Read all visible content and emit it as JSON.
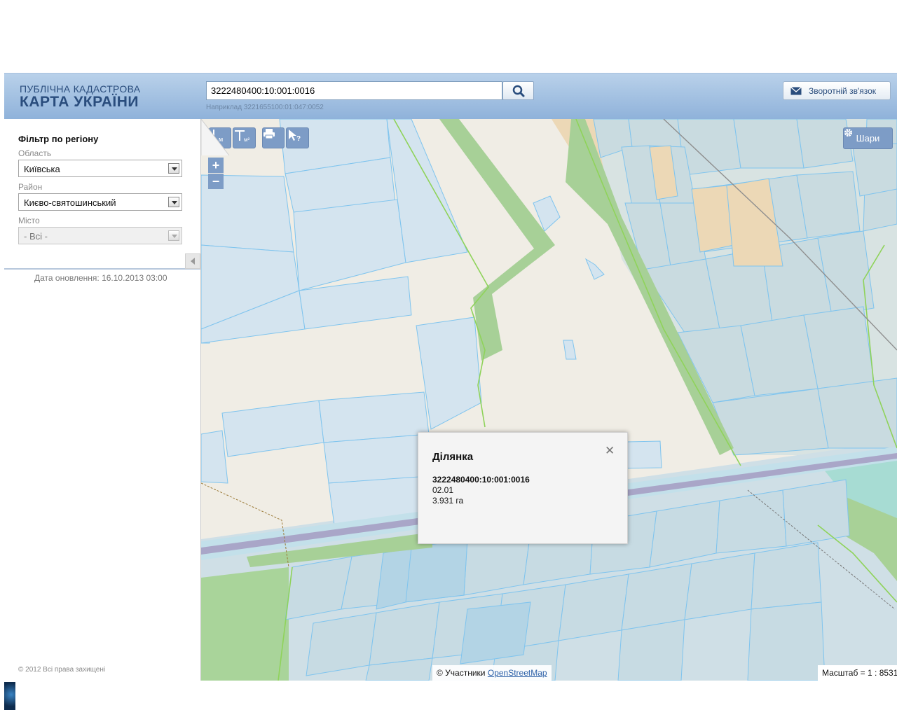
{
  "header": {
    "logo_line1": "ПУБЛІЧНА КАДАСТРОВА",
    "logo_line2": "КАРТА УКРАЇНИ",
    "search_value": "3222480400:10:001:0016",
    "search_hint": "Наприклад 3221655100:01:047:0052",
    "feedback_label": "Зворотній зв'язок"
  },
  "sidebar": {
    "title": "Фільтр по регіону",
    "oblast_label": "Область",
    "oblast_value": "Київська",
    "rayon_label": "Район",
    "rayon_value": "Києво-святошинський",
    "misto_label": "Місто",
    "misto_value": "- Всі -",
    "update_date": "Дата оновлення: 16.10.2013 03:00",
    "copyright": "© 2012 Всі права захищені"
  },
  "map": {
    "tools": {
      "measure_line_label": "м",
      "measure_area_label": "м²",
      "zoom_in": "+",
      "zoom_out": "−",
      "layers_label": "Шари"
    },
    "popup": {
      "title": "Ділянка",
      "cadastral_number": "3222480400:10:001:0016",
      "purpose_code": "02.01",
      "area": "3.931 га"
    },
    "attribution_prefix": "© Участники",
    "attribution_link": "OpenStreetMap",
    "scale_label": "Масштаб = 1 : 8531"
  },
  "colors": {
    "parcel_fill": "#d4e4ef",
    "parcel_stroke": "#7fc4ee",
    "greenbelt": "#a7d097",
    "orange_zone": "#ecd8b6",
    "road": "#a9a6c8",
    "tool_blue": "#7d9cc6"
  }
}
